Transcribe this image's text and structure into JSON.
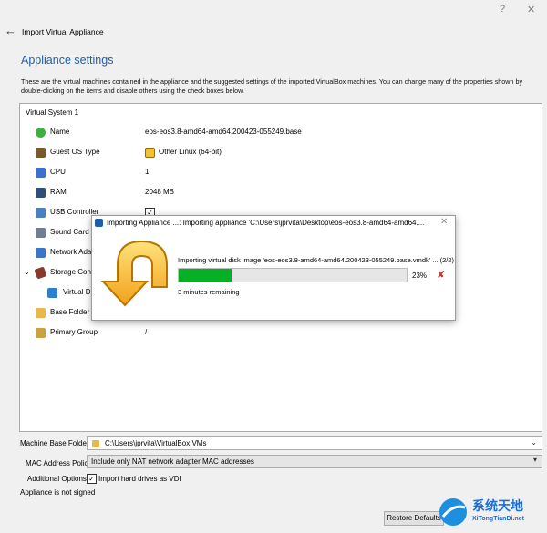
{
  "window": {
    "help_glyph": "?",
    "close_glyph": "✕"
  },
  "wizard": {
    "title": "Import Virtual Appliance",
    "heading": "Appliance settings",
    "description": "These are the virtual machines contained in the appliance and the suggested settings of the imported VirtualBox machines. You can change many of the properties shown by double-clicking on the items and disable others using the check boxes below."
  },
  "tree": {
    "system_label": "Virtual System 1",
    "rows": [
      {
        "label": "Name",
        "value": "eos-eos3.8-amd64-amd64.200423-055249.base",
        "icon": "name-icon",
        "color": "#3cb043"
      },
      {
        "label": "Guest OS Type",
        "value": "Other Linux (64-bit)",
        "icon": "os-type-icon",
        "color": "#7a5a2a"
      },
      {
        "label": "CPU",
        "value": "1",
        "icon": "cpu-icon",
        "color": "#3d6fd1"
      },
      {
        "label": "RAM",
        "value": "2048 MB",
        "icon": "ram-icon",
        "color": "#2d4f7a"
      },
      {
        "label": "USB Controller",
        "value": "✓",
        "icon": "usb-icon",
        "color": "#4a7fc1"
      },
      {
        "label": "Sound Card",
        "value": "",
        "icon": "sound-card-icon",
        "color": "#6e7e90"
      },
      {
        "label": "Network Ada",
        "value": "",
        "icon": "network-adapter-icon",
        "color": "#3b76c4"
      },
      {
        "label": "Storage Contr",
        "value": "",
        "icon": "storage-controller-icon",
        "color": "#8a3a2a"
      },
      {
        "label": "Virtual Di",
        "value": "",
        "icon": "virtual-disk-icon",
        "color": "#2f7fd0"
      },
      {
        "label": "Base Folder",
        "value": "",
        "icon": "folder-icon",
        "color": "#e8b84a"
      },
      {
        "label": "Primary Group",
        "value": "/",
        "icon": "group-icon",
        "color": "#c9a23f"
      }
    ]
  },
  "form": {
    "machine_base_folder_label": "Machine Base Folder:",
    "machine_base_folder_value": "C:\\Users\\jprvita\\VirtualBox VMs",
    "mac_policy_label": "MAC Address Policy:",
    "mac_policy_value": "Include only NAT network adapter MAC addresses",
    "additional_options_label": "Additional Options:",
    "import_vdi_label": "Import hard drives as VDI",
    "import_vdi_checked": "✓",
    "signature_status": "Appliance is not signed",
    "restore_defaults_label": "Restore Defaults"
  },
  "dialog": {
    "title": "Importing Appliance ...: Importing appliance 'C:\\Users\\jprvita\\Desktop\\eos-eos3.8-amd64-amd64....",
    "close_glyph": "✕",
    "status": "Importing virtual disk image 'eos-eos3.8-amd64-amd64.200423-055249.base.vmdk' ... (2/2)",
    "progress_fraction": 0.23,
    "progress_text": "23%",
    "time_remaining": "3 minutes remaining",
    "cancel_glyph": "✘"
  },
  "watermark": {
    "title": "系统天地",
    "url": "XiTongTianDi.net"
  }
}
